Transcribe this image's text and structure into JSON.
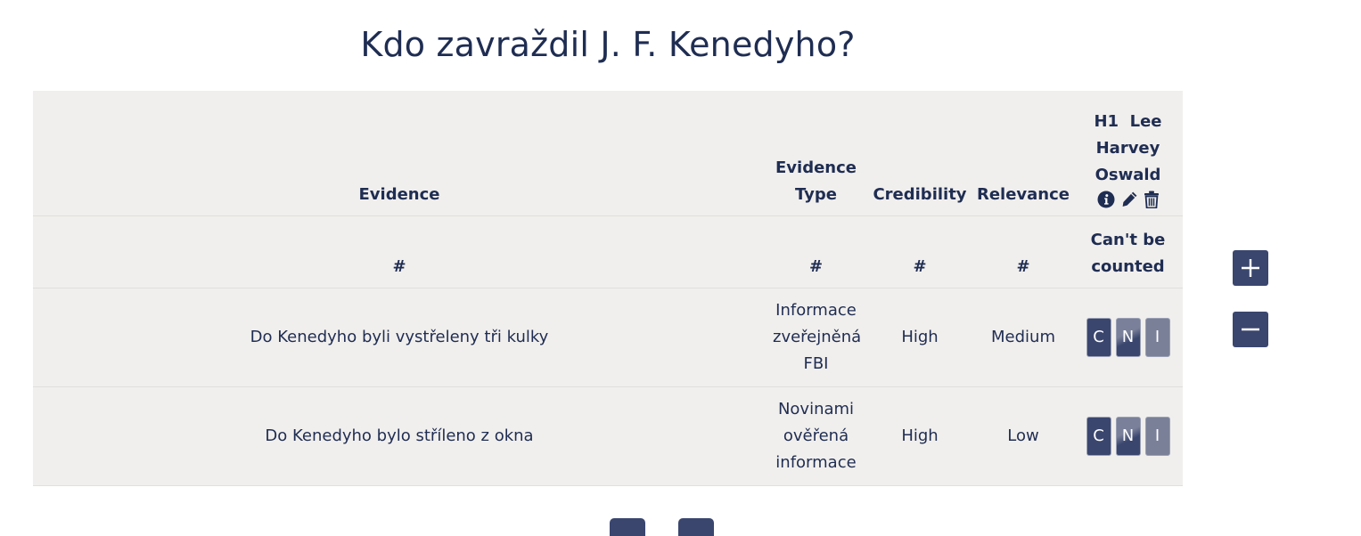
{
  "title": "Kdo zavraždil J. F. Kenedyho?",
  "table": {
    "headers": {
      "evidence": "Evidence",
      "evidence_type_line1": "Evidence",
      "evidence_type_line2": "Type",
      "credibility": "Credibility",
      "relevance": "Relevance"
    },
    "hypothesis": {
      "id": "H1",
      "name_line1": "Lee",
      "name_line2": "Harvey",
      "name_line3": "Oswald",
      "icons": [
        "info-icon",
        "pencil-icon",
        "trash-icon"
      ]
    },
    "subheader": {
      "evidence": "#",
      "evidence_type": "#",
      "credibility": "#",
      "relevance": "#",
      "hyp_line1": "Can't be",
      "hyp_line2": "counted"
    },
    "rows": [
      {
        "evidence": "Do Kenedyho byli vystřeleny tři kulky",
        "type_line1": "Informace",
        "type_line2": "zveřejněná",
        "type_line3": "FBI",
        "credibility": "High",
        "relevance": "Medium",
        "buttons": [
          "C",
          "N",
          "I"
        ]
      },
      {
        "evidence": "Do Kenedyho bylo stříleno z okna",
        "type_line1": "Novinami",
        "type_line2": "ověřená",
        "type_line3": "informace",
        "credibility": "High",
        "relevance": "Low",
        "buttons": [
          "C",
          "N",
          "I"
        ]
      }
    ]
  },
  "controls": {
    "add_icon": "plus-icon",
    "remove_icon": "minus-icon"
  },
  "colors": {
    "text": "#1f2d52",
    "table_bg": "#f1efed",
    "button_dark": "#3a466e",
    "button_light": "#7b8099"
  }
}
